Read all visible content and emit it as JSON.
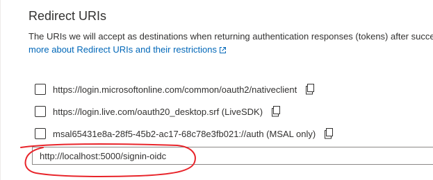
{
  "section": {
    "title": "Redirect URIs",
    "description": "The URIs we will accept as destinations when returning authentication responses (tokens) after succes",
    "learn_more_link": "more about Redirect URIs and their restrictions"
  },
  "icons": {
    "external_link": "external-link-icon",
    "copy": "copy-icon",
    "checkbox": "checkbox-unchecked"
  },
  "uris": [
    {
      "value": "https://login.microsoftonline.com/common/oauth2/nativeclient",
      "checked": false
    },
    {
      "value": "https://login.live.com/oauth20_desktop.srf (LiveSDK)",
      "checked": false
    },
    {
      "value": "msal65431e8a-28f5-45b2-ac17-68c78e3fb021://auth (MSAL only)",
      "checked": false
    }
  ],
  "new_uri_input": {
    "value": "http://localhost:5000/signin-oidc",
    "placeholder": ""
  },
  "colors": {
    "link": "#0067b8",
    "text": "#323130",
    "annotation": "#e8242a"
  }
}
